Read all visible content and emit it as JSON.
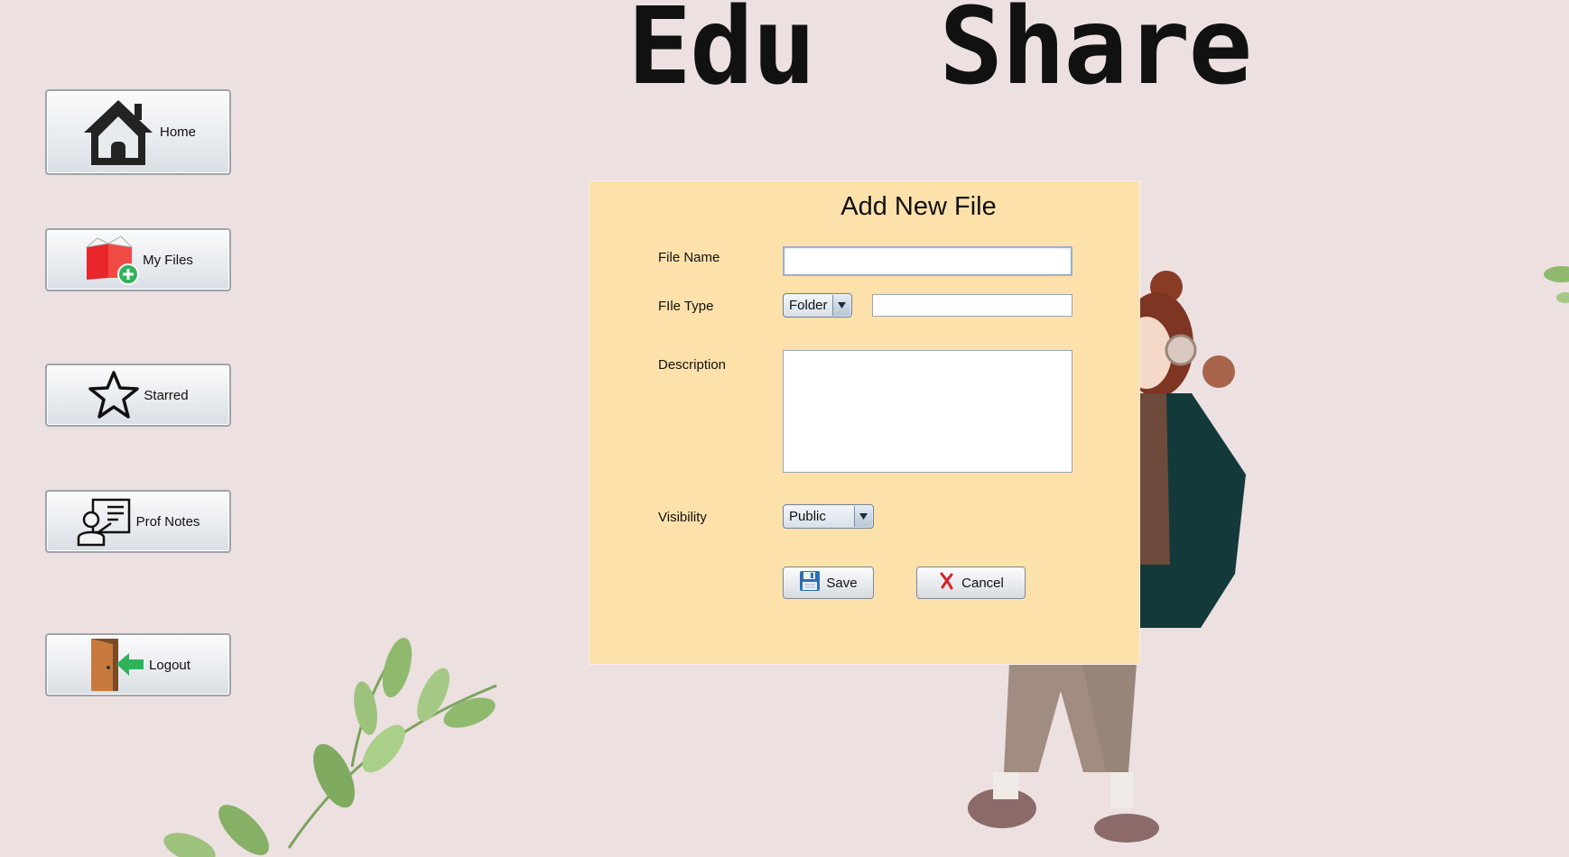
{
  "app": {
    "title": "Edu  Share"
  },
  "sidebar": {
    "items": [
      {
        "label": "Home",
        "icon": "home-icon"
      },
      {
        "label": "My Files",
        "icon": "folder-add-icon"
      },
      {
        "label": "Starred",
        "icon": "star-icon"
      },
      {
        "label": "Prof Notes",
        "icon": "professor-board-icon"
      },
      {
        "label": "Logout",
        "icon": "logout-door-icon"
      }
    ]
  },
  "dialog": {
    "title": "Add New File",
    "file_name": {
      "label": "File Name",
      "value": ""
    },
    "file_type": {
      "label": "FIle Type",
      "selected": "Folder",
      "extra_value": ""
    },
    "description": {
      "label": "Description",
      "value": ""
    },
    "visibility": {
      "label": "Visibility",
      "selected": "Public"
    },
    "save_label": "Save",
    "cancel_label": "Cancel"
  },
  "colors": {
    "background": "#ece0e1",
    "dialog_bg": "#fde1ab",
    "accent_red": "#e8262b",
    "accent_green": "#2fb25a"
  }
}
